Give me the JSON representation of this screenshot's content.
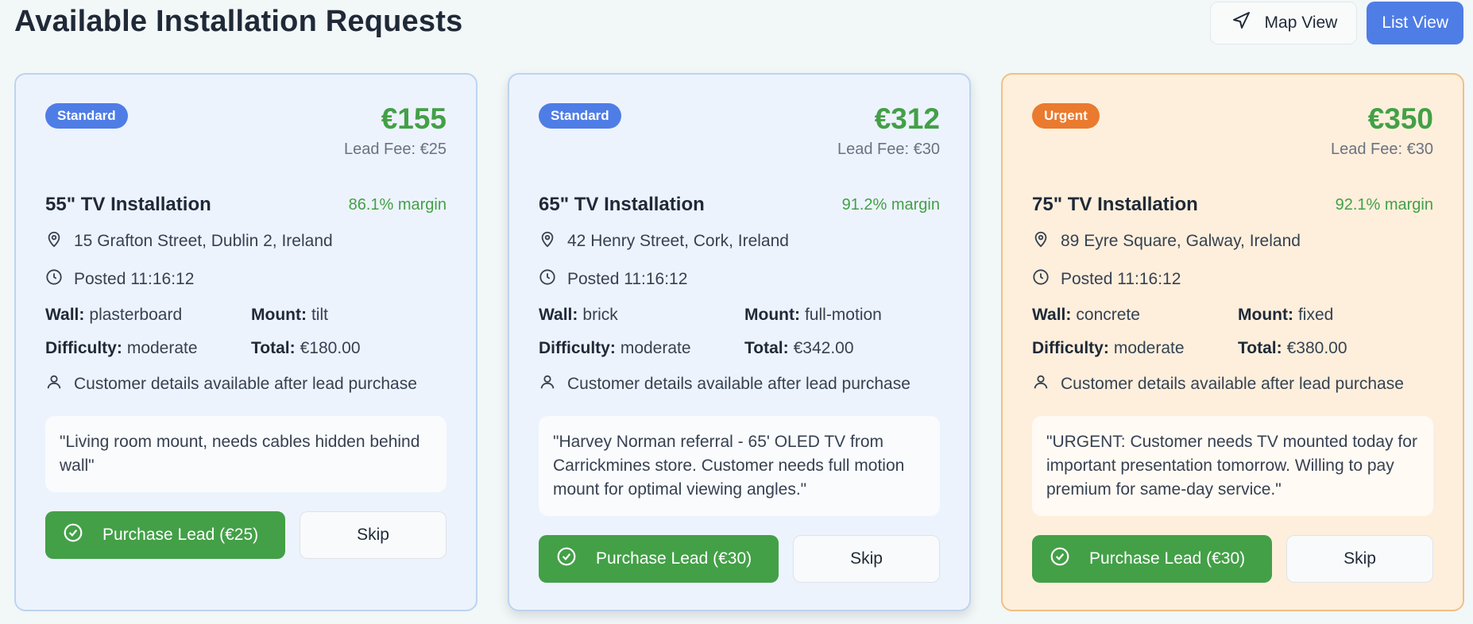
{
  "header": {
    "title": "Available Installation Requests",
    "map_view_label": "Map View",
    "list_view_label": "List View"
  },
  "colors": {
    "accent": "#4f7de6",
    "success": "#43a047",
    "urgent": "#ea7a2e"
  },
  "cards": [
    {
      "badge": "Standard",
      "price": "€155",
      "lead_fee": "Lead Fee: €25",
      "title": "55\" TV Installation",
      "margin": "86.1% margin",
      "address": "15 Grafton Street, Dublin 2, Ireland",
      "posted": "Posted 11:16:12",
      "wall_label": "Wall:",
      "wall": "plasterboard",
      "mount_label": "Mount:",
      "mount": "tilt",
      "difficulty_label": "Difficulty:",
      "difficulty": "moderate",
      "total_label": "Total:",
      "total": "€180.00",
      "customer_note": "Customer details available after lead purchase",
      "note": "\"Living room mount, needs cables hidden behind wall\"",
      "purchase_label": "Purchase Lead (€25)",
      "skip_label": "Skip"
    },
    {
      "badge": "Standard",
      "price": "€312",
      "lead_fee": "Lead Fee: €30",
      "title": "65\" TV Installation",
      "margin": "91.2% margin",
      "address": "42 Henry Street, Cork, Ireland",
      "posted": "Posted 11:16:12",
      "wall_label": "Wall:",
      "wall": "brick",
      "mount_label": "Mount:",
      "mount": "full-motion",
      "difficulty_label": "Difficulty:",
      "difficulty": "moderate",
      "total_label": "Total:",
      "total": "€342.00",
      "customer_note": "Customer details available after lead purchase",
      "note": "\"Harvey Norman referral - 65' OLED TV from Carrickmines store. Customer needs full motion mount for optimal viewing angles.\"",
      "purchase_label": "Purchase Lead (€30)",
      "skip_label": "Skip"
    },
    {
      "badge": "Urgent",
      "price": "€350",
      "lead_fee": "Lead Fee: €30",
      "title": "75\" TV Installation",
      "margin": "92.1% margin",
      "address": "89 Eyre Square, Galway, Ireland",
      "posted": "Posted 11:16:12",
      "wall_label": "Wall:",
      "wall": "concrete",
      "mount_label": "Mount:",
      "mount": "fixed",
      "difficulty_label": "Difficulty:",
      "difficulty": "moderate",
      "total_label": "Total:",
      "total": "€380.00",
      "customer_note": "Customer details available after lead purchase",
      "note": "\"URGENT: Customer needs TV mounted today for important presentation tomorrow. Willing to pay premium for same-day service.\"",
      "purchase_label": "Purchase Lead (€30)",
      "skip_label": "Skip"
    }
  ]
}
